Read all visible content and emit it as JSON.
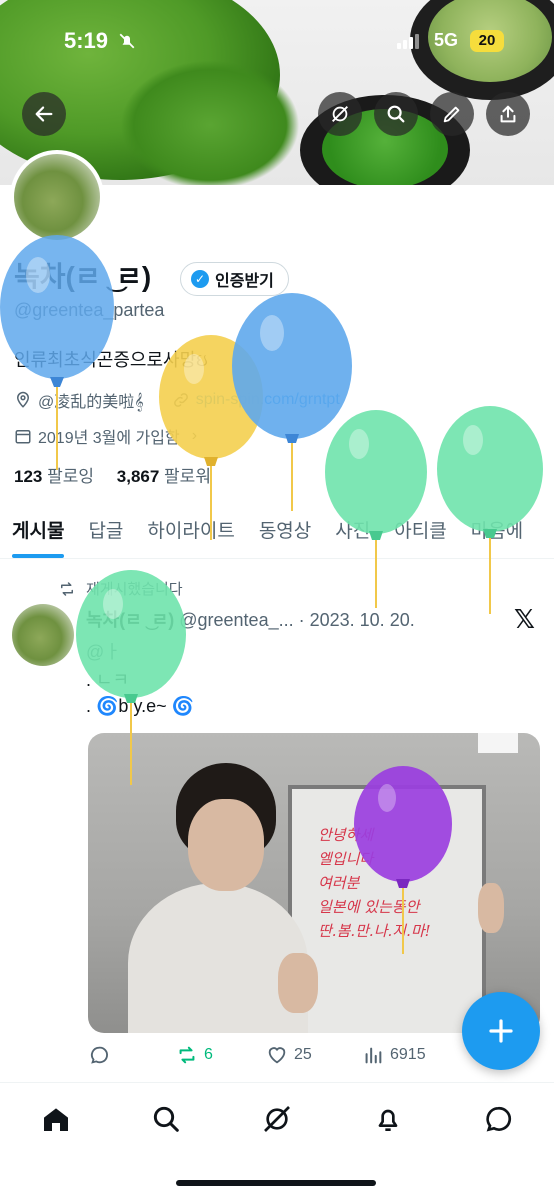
{
  "status_bar": {
    "time": "5:19",
    "network": "5G",
    "battery": "20"
  },
  "header_buttons": [
    "back",
    "grok",
    "search",
    "edit",
    "share"
  ],
  "profile": {
    "name": "녹차(ㄹ ͜ ㄹ)",
    "handle": "@greentea_partea",
    "verify_label": "인증받기",
    "bio": "인류최초식곤증으로사망ઇ",
    "location": "@凌乱的美啦𝄞",
    "website": "spin-spin.com/grntpt",
    "joined": "2019년 3월에 가입함",
    "following_count": "123",
    "following_label": "팔로잉",
    "followers_count": "3,867",
    "followers_label": "팔로워"
  },
  "tabs": [
    "게시물",
    "답글",
    "하이라이트",
    "동영상",
    "사진",
    "아티클",
    "마음에"
  ],
  "post": {
    "repost_note": "재게시했습니다",
    "author_name": "녹차(ㄹ ͜ ㄹ)",
    "author_handle": "@greentea_...",
    "date": "· 2023. 10. 20.",
    "lines": [
      "@ㅏ",
      ". ㄴㅋ",
      ".  🌀b.y.e~ 🌀"
    ],
    "image_writing": "안녕하세\n엘입니다\n여러분\n일본에 있는동안\n딴.봄.만.나.지.마!",
    "replies": "",
    "reposts": "6",
    "likes": "25",
    "views": "6915"
  },
  "colors": {
    "accent": "#1d9bf0",
    "repost_green": "#00ba7c",
    "balloon_blue": "#5fa8ec",
    "balloon_yellow": "#f4cf4f",
    "balloon_green": "#6fe3ac",
    "balloon_purple": "#9a3ee0"
  }
}
